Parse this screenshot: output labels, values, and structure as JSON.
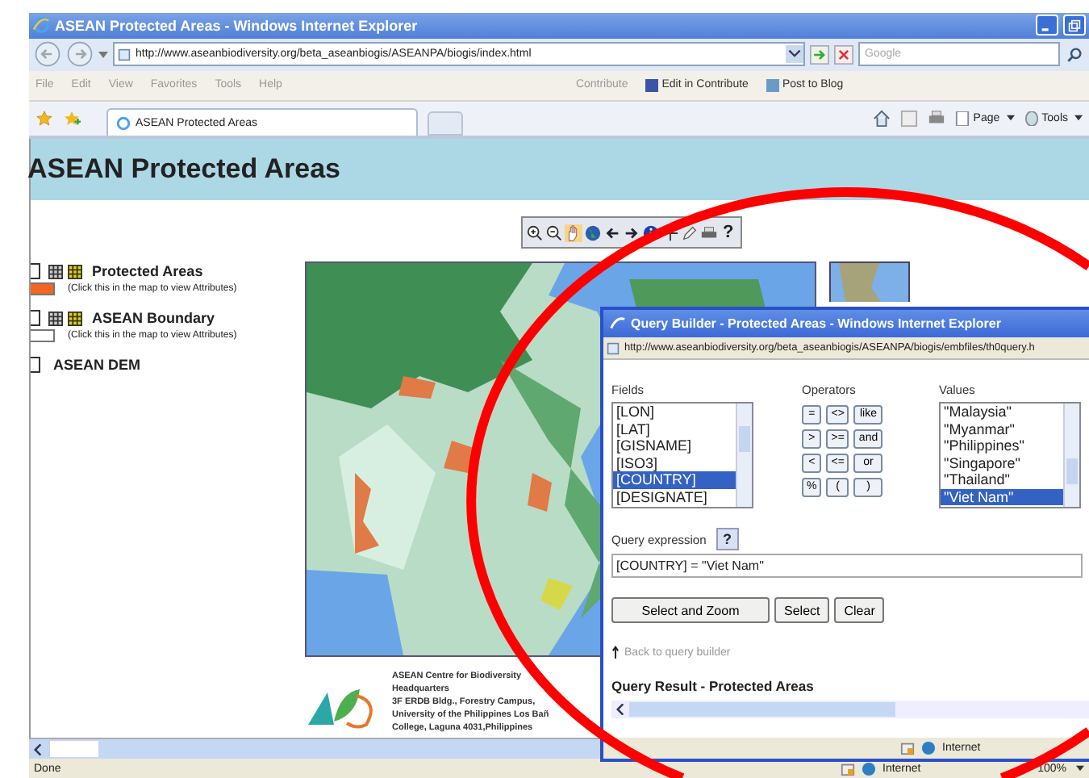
{
  "window": {
    "title": "ASEAN Protected Areas - Windows Internet Explorer"
  },
  "address_bar": {
    "url": "http://www.aseanbiodiversity.org/beta_aseanbiogis/ASEANPA/biogis/index.html",
    "search_placeholder": "Google"
  },
  "menu": [
    "File",
    "Edit",
    "View",
    "Favorites",
    "Tools",
    "Help"
  ],
  "links_bar": {
    "label": "Contribute",
    "items": [
      "Edit in Contribute",
      "Post to Blog"
    ]
  },
  "tabs": [
    {
      "label": "ASEAN Protected Areas",
      "selected": true
    }
  ],
  "command_bar": [
    "Page",
    "Tools"
  ],
  "page": {
    "title": "ASEAN Protected Areas",
    "map_tools": {
      "help": "?"
    },
    "layers": [
      {
        "name": "Protected Areas",
        "checked": false,
        "hint": "(Click this in the map to view Attributes)",
        "color": "#f26522"
      },
      {
        "name": "ASEAN Boundary",
        "checked": false,
        "hint": "(Click this in the map to view Attributes)",
        "color": "#ffffff"
      },
      {
        "name": "ASEAN DEM",
        "checked": false
      }
    ],
    "map": {
      "kind": "picture"
    },
    "footer": [
      "ASEAN Centre for Biodiversity",
      "Headquarters",
      "3F ERDB Bldg., Forestry Campus,",
      "University of the Philippines Los Bañ",
      "College, Laguna 4031,Philippines"
    ]
  },
  "status_bar": {
    "text": "Done",
    "zone": "Internet",
    "zoom": "100%"
  },
  "dialog": {
    "title": "Query Builder - Protected Areas - Windows Internet Explorer",
    "url": "http://www.aseanbiodiversity.org/beta_aseanbiogis/ASEANPA/biogis/embfiles/th0query.h",
    "fields_label": "Fields",
    "fields": [
      {
        "label": "[LON]",
        "selected": false
      },
      {
        "label": "[LAT]",
        "selected": false
      },
      {
        "label": "[GISNAME]",
        "selected": false
      },
      {
        "label": "[ISO3]",
        "selected": false
      },
      {
        "label": "[COUNTRY]",
        "selected": true
      },
      {
        "label": "[DESIGNATE]",
        "selected": false
      }
    ],
    "operators_label": "Operators",
    "operators": [
      "=",
      "<>",
      "like",
      ">",
      ">=",
      "and",
      "<",
      "<=",
      "or",
      "%",
      "(",
      ")"
    ],
    "values_label": "Values",
    "values": [
      {
        "label": "\"Malaysia\"",
        "selected": false
      },
      {
        "label": "\"Myanmar\"",
        "selected": false
      },
      {
        "label": "\"Philippines\"",
        "selected": false
      },
      {
        "label": "\"Singapore\"",
        "selected": false
      },
      {
        "label": "\"Thailand\"",
        "selected": false
      },
      {
        "label": "\"Viet Nam\"",
        "selected": true
      }
    ],
    "expression_label": "Query expression",
    "help": "?",
    "expression": "[COUNTRY] = \"Viet Nam\"",
    "buttons": [
      "Select and Zoom",
      "Select",
      "Clear"
    ],
    "back_link": "Back to query builder",
    "result_heading": "Query Result - Protected Areas",
    "status": "Internet"
  }
}
